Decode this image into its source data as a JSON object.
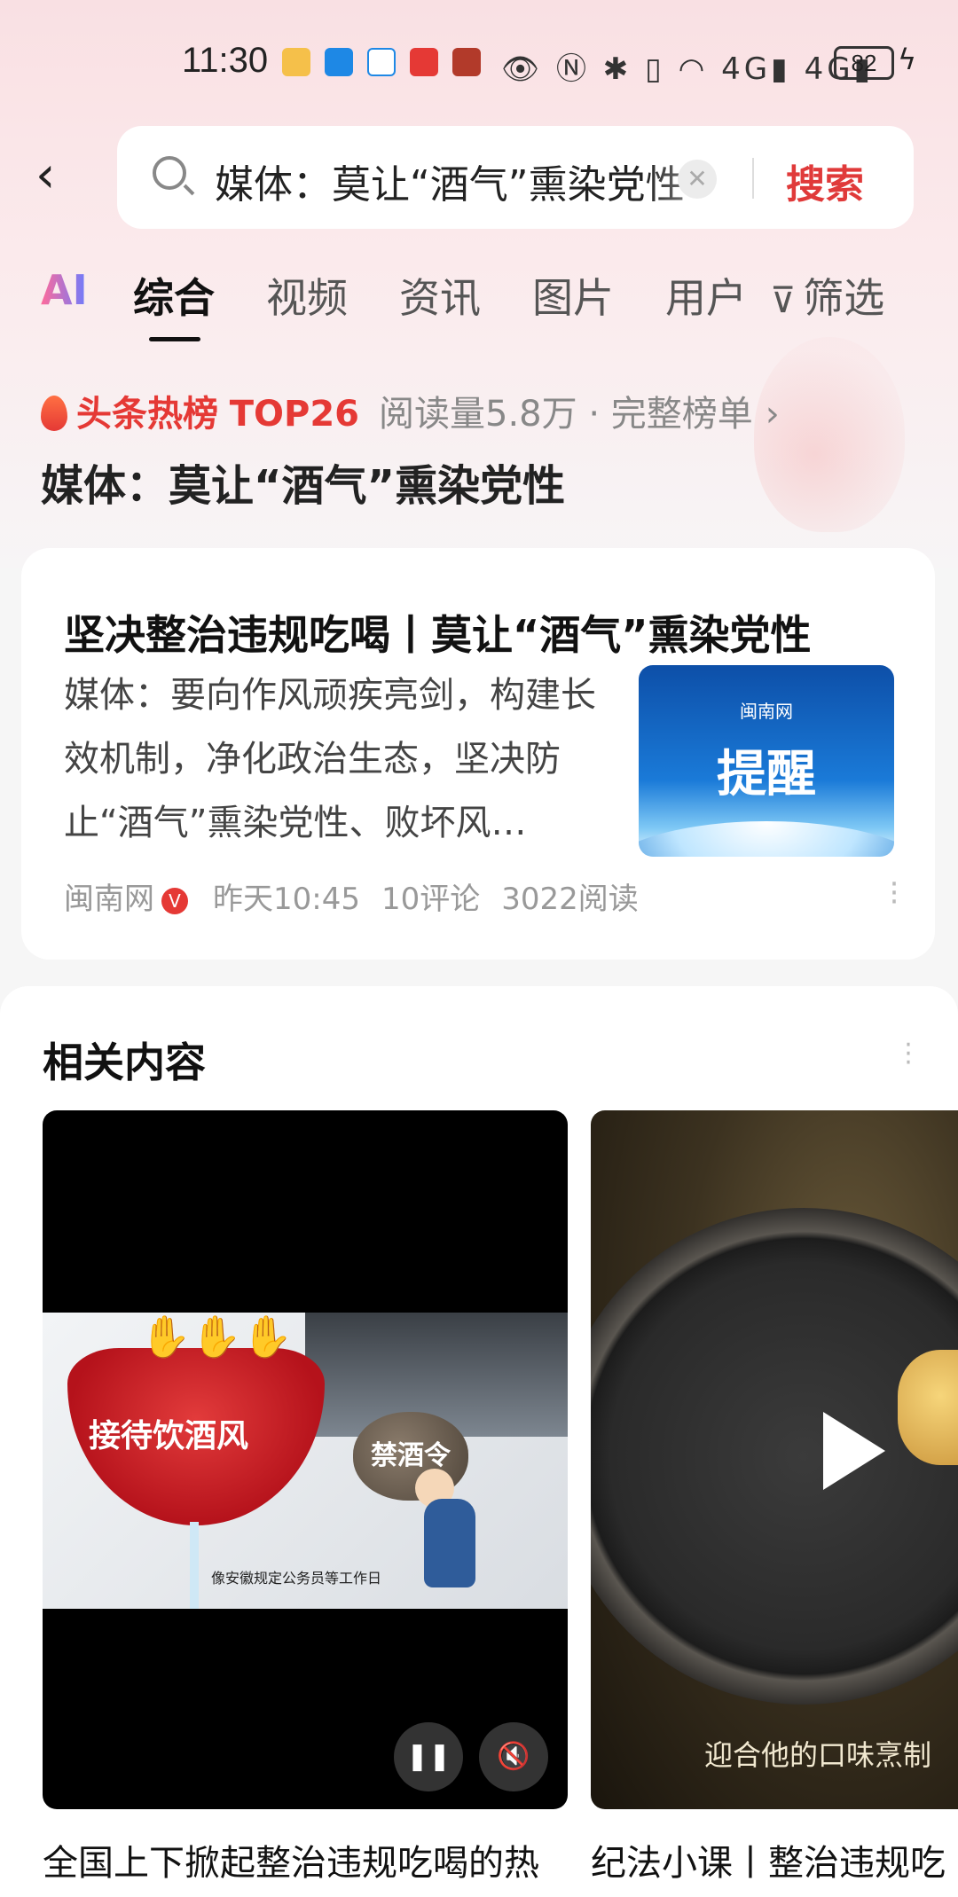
{
  "status_bar": {
    "time": "11:30",
    "battery": "82",
    "icons": [
      "eye-icon",
      "nfc-icon",
      "bluetooth-icon",
      "vibrate-icon",
      "wifi-icon",
      "signal-4g-icon",
      "signal-4g-icon"
    ]
  },
  "search": {
    "query": "媒体：莫让“酒气”熏染党性",
    "button_label": "搜索"
  },
  "tabs": {
    "ai": "AI",
    "items": [
      "综合",
      "视频",
      "资讯",
      "图片",
      "用户"
    ],
    "active": "综合",
    "filter_label": "筛选"
  },
  "hot": {
    "brand": "头条热榜",
    "rank": "TOP26",
    "meta": "阅读量5.8万 · 完整榜单",
    "title": "媒体：莫让“酒气”熏染党性"
  },
  "article": {
    "title": "坚决整治违规吃喝丨莫让“酒气”熏染党性",
    "snippet": "媒体：要向作风顽疾亮剑，构建长效机制，净化政治生态，坚决防止“酒气”熏染党性、败坏风…",
    "thumb_logo": "闽南网",
    "thumb_text": "提醒",
    "source": "闽南网",
    "verified": "V",
    "time": "昨天10:45",
    "comments": "10评论",
    "reads": "3022阅读"
  },
  "related": {
    "title": "相关内容",
    "videos": [
      {
        "title": "全国上下掀起整治违规吃喝的热",
        "overlay_text_1": "接待饮酒风",
        "overlay_text_2": "禁酒令",
        "subtitle": "像安徽规定公务员等工作日"
      },
      {
        "title": "纪法小课丨整治违规吃",
        "subtitle": "迎合他的口味烹制"
      }
    ]
  },
  "colors": {
    "accent_red": "#e53935",
    "search_red": "#e03a3a"
  }
}
